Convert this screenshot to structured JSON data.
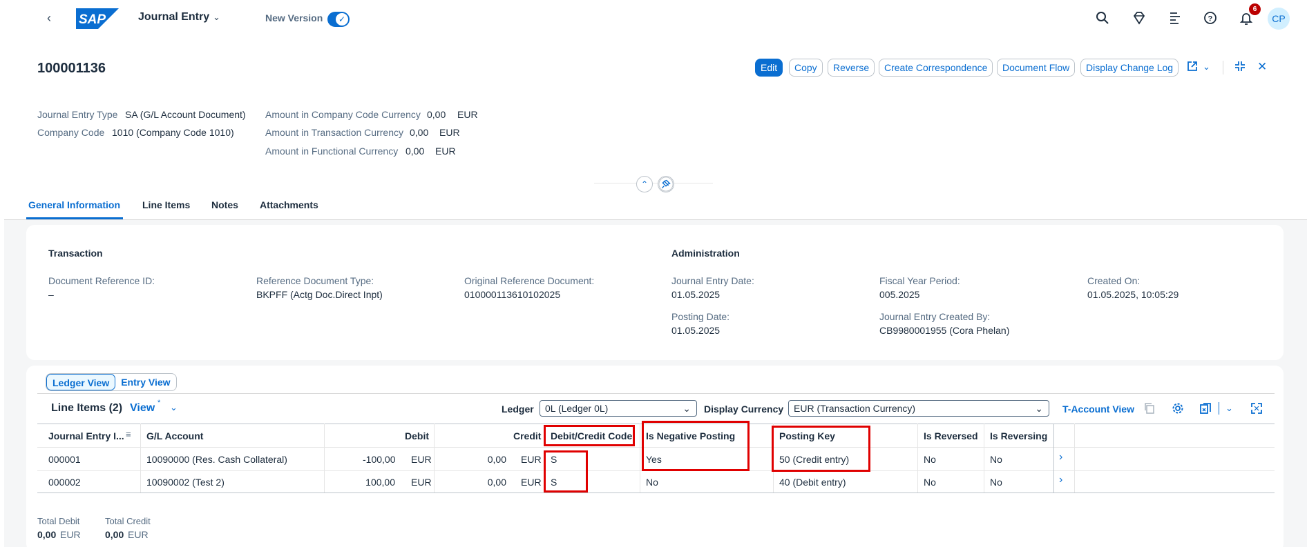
{
  "shell": {
    "logo": "SAP",
    "app_title": "Journal Entry",
    "new_version_label": "New Version",
    "notification_count": "6",
    "avatar_initials": "CP"
  },
  "header": {
    "document_id": "100001136",
    "actions": [
      "Edit",
      "Copy",
      "Reverse",
      "Create Correspondence",
      "Document Flow",
      "Display Change Log"
    ],
    "attributes_left": [
      {
        "label": "Journal Entry Type",
        "value": "SA (G/L Account Document)"
      },
      {
        "label": "Company Code",
        "value": "1010 (Company Code 1010)"
      }
    ],
    "attributes_right": [
      {
        "label": "Amount in Company Code Currency",
        "value": "0,00",
        "unit": "EUR"
      },
      {
        "label": "Amount in Transaction Currency",
        "value": "0,00",
        "unit": "EUR"
      },
      {
        "label": "Amount in Functional Currency",
        "value": "0,00",
        "unit": "EUR"
      }
    ]
  },
  "tabs": [
    "General Information",
    "Line Items",
    "Notes",
    "Attachments"
  ],
  "general": {
    "transaction_title": "Transaction",
    "administration_title": "Administration",
    "fields": {
      "doc_ref_label": "Document Reference ID:",
      "doc_ref_value": "–",
      "ref_doc_type_label": "Reference Document Type:",
      "ref_doc_type_value": "BKPFF (Actg Doc.Direct Inpt)",
      "orig_ref_label": "Original Reference Document:",
      "orig_ref_value": "010000113610102025",
      "je_date_label": "Journal Entry Date:",
      "je_date_value": "01.05.2025",
      "fy_period_label": "Fiscal Year Period:",
      "fy_period_value": "005.2025",
      "created_on_label": "Created On:",
      "created_on_value": "01.05.2025, 10:05:29",
      "posting_date_label": "Posting Date:",
      "posting_date_value": "01.05.2025",
      "created_by_label": "Journal Entry Created By:",
      "created_by_value": "CB9980001955 (Cora Phelan)"
    }
  },
  "line_items": {
    "segments": [
      "Ledger View",
      "Entry View"
    ],
    "title": "Line Items (2)",
    "view_label": "View",
    "view_modified": "*",
    "ledger_label": "Ledger",
    "ledger_value": "0L (Ledger 0L)",
    "currency_label": "Display Currency",
    "currency_value": "EUR (Transaction Currency)",
    "taccount_label": "T-Account View",
    "columns": [
      "Journal Entry I...",
      "G/L Account",
      "Debit",
      "Credit",
      "Debit/Credit Code",
      "Is Negative Posting",
      "Posting Key",
      "Is Reversed",
      "Is Reversing"
    ],
    "rows": [
      {
        "item": "000001",
        "account": "10090000 (Res. Cash Collateral)",
        "debit": "-100,00",
        "debit_cur": "EUR",
        "credit": "0,00",
        "credit_cur": "EUR",
        "dc_code": "S",
        "negative": "Yes",
        "posting_key": "50 (Credit entry)",
        "reversed": "No",
        "reversing": "No"
      },
      {
        "item": "000002",
        "account": "10090002 (Test 2)",
        "debit": "100,00",
        "debit_cur": "EUR",
        "credit": "0,00",
        "credit_cur": "EUR",
        "dc_code": "S",
        "negative": "No",
        "posting_key": "40 (Debit entry)",
        "reversed": "No",
        "reversing": "No"
      }
    ],
    "total_debit_label": "Total Debit",
    "total_debit_value": "0,00",
    "total_debit_unit": "EUR",
    "total_credit_label": "Total Credit",
    "total_credit_value": "0,00",
    "total_credit_unit": "EUR"
  },
  "colors": {
    "accent": "#0a6ed1",
    "highlight_box": "#e00000"
  }
}
